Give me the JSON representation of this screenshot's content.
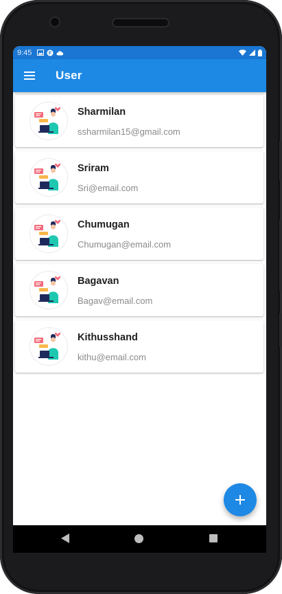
{
  "status_bar": {
    "time": "9:45"
  },
  "app_bar": {
    "title": "User"
  },
  "users": [
    {
      "name": "Sharmilan",
      "email": "ssharmilan15@gmail.com"
    },
    {
      "name": "Sriram",
      "email": "Sri@email.com"
    },
    {
      "name": "Chumugan",
      "email": "Chumugan@email.com"
    },
    {
      "name": "Bagavan",
      "email": "Bagav@email.com"
    },
    {
      "name": "Kithusshand",
      "email": "kithu@email.com"
    }
  ],
  "fab": {
    "icon": "add-icon"
  },
  "nav": {
    "icons": [
      "back-icon",
      "home-icon",
      "recents-icon"
    ]
  },
  "colors": {
    "primary": "#1e88e5",
    "status_bar": "#1a76d2",
    "name_text": "#1f1f1f",
    "email_text": "#8a8a8a"
  }
}
